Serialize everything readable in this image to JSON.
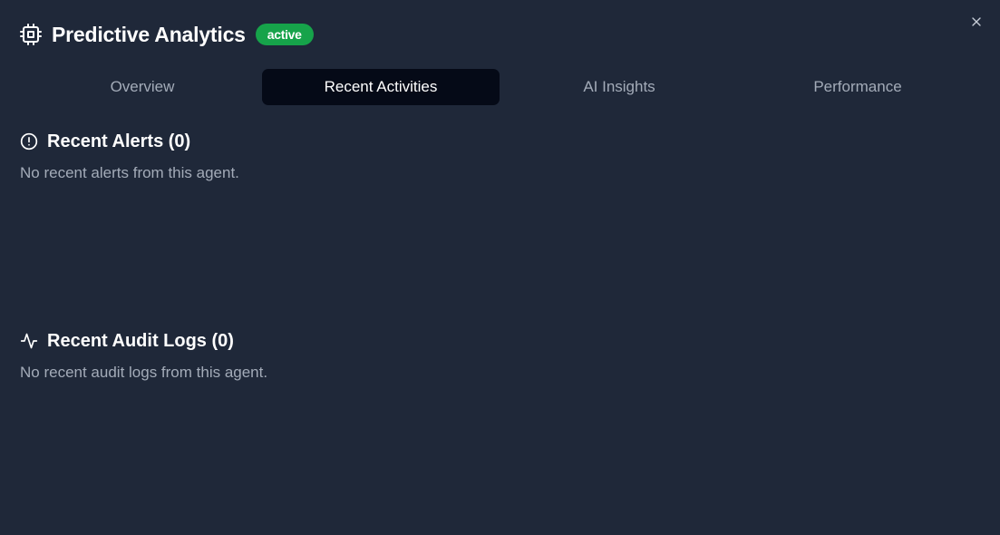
{
  "dialog": {
    "title": "Predictive Analytics",
    "status_badge": "active",
    "title_icon": "cpu-chip-icon",
    "close_icon": "close-icon"
  },
  "tabs": [
    {
      "label": "Overview",
      "active": false
    },
    {
      "label": "Recent Activities",
      "active": true
    },
    {
      "label": "AI Insights",
      "active": false
    },
    {
      "label": "Performance",
      "active": false
    }
  ],
  "alerts": {
    "title": "Recent Alerts (0)",
    "icon": "alert-circle-icon",
    "empty_text": "No recent alerts from this agent."
  },
  "audit_logs": {
    "title": "Recent Audit Logs (0)",
    "icon": "activity-icon",
    "empty_text": "No recent audit logs from this agent."
  },
  "colors": {
    "background": "#1f2839",
    "active_tab": "#050a17",
    "badge": "#16a34a",
    "muted_text": "#a3abb8"
  }
}
